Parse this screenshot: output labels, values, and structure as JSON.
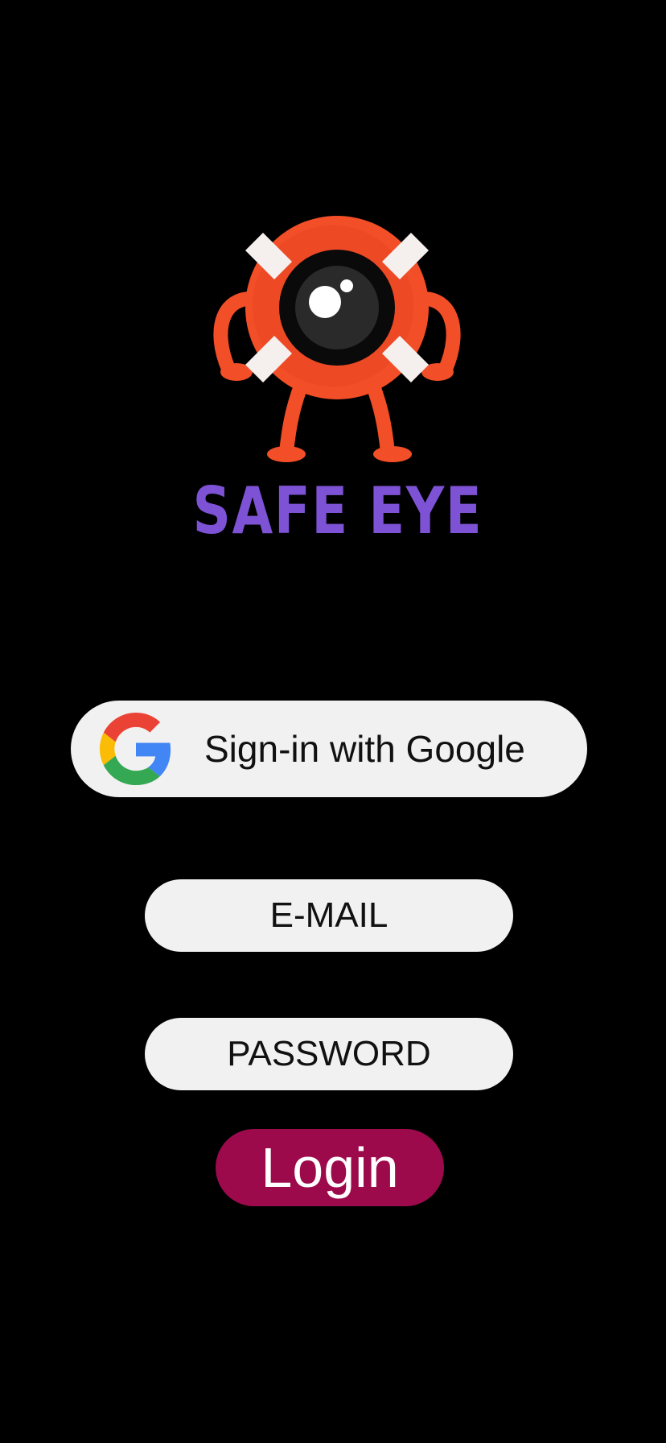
{
  "app": {
    "brand_name": "SAFE EYE",
    "mascot_icon": "lifebuoy-eye-mascot-icon"
  },
  "google_signin": {
    "label": "Sign-in with Google",
    "icon": "google-g-icon"
  },
  "form": {
    "email_placeholder": "E-MAIL",
    "email_value": "",
    "password_placeholder": "PASSWORD",
    "password_value": "",
    "login_label": "Login"
  },
  "colors": {
    "background": "#000000",
    "brand_purple": "#7d52d4",
    "mascot_orange": "#f24e27",
    "pill_background": "#f1f1f1",
    "login_button": "#9c0a4c"
  }
}
